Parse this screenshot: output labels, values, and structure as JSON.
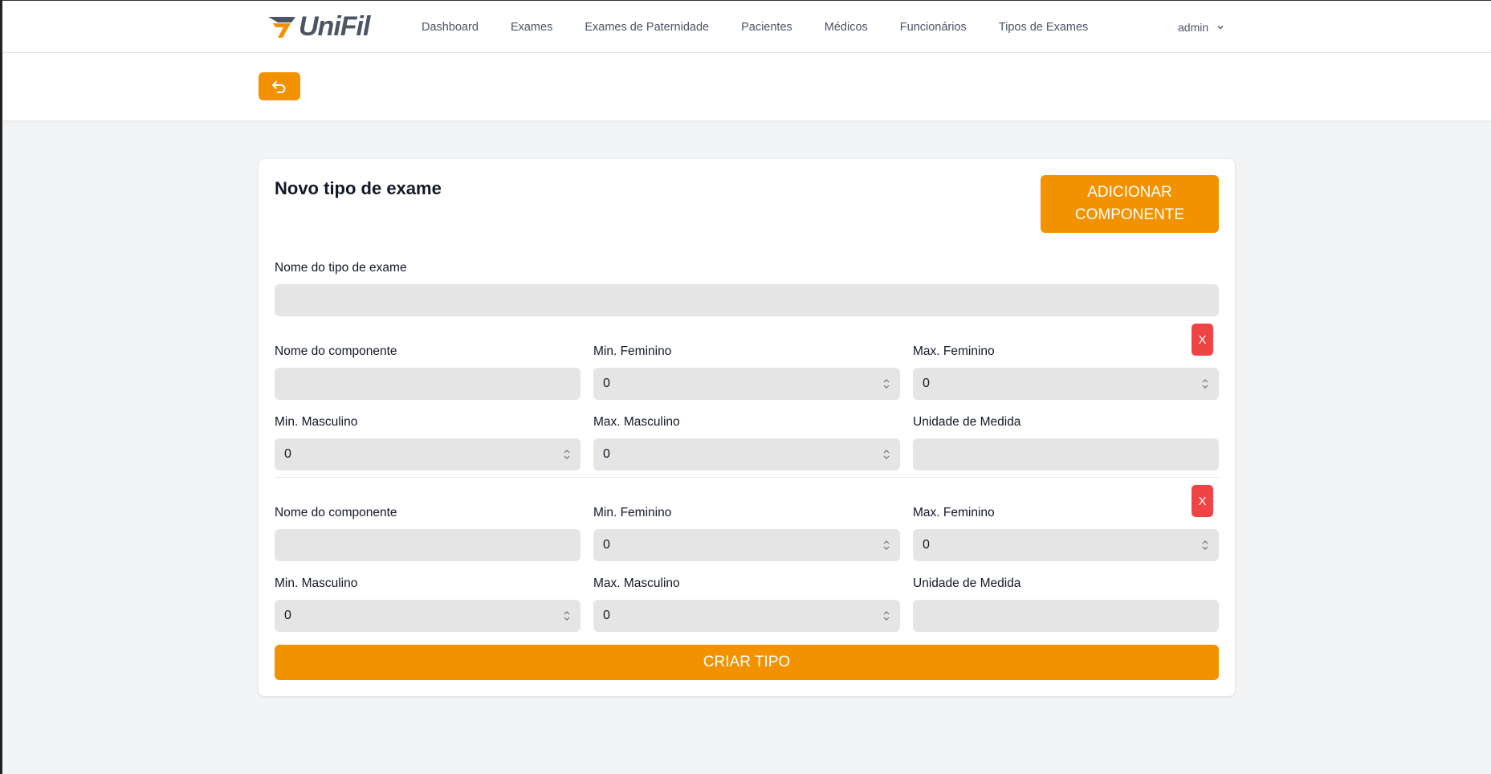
{
  "brand": {
    "logo_text": "UniFil",
    "accent_color": "#f39200",
    "danger_color": "#ef4444"
  },
  "nav": {
    "links": [
      "Dashboard",
      "Exames",
      "Exames de Paternidade",
      "Pacientes",
      "Médicos",
      "Funcionários",
      "Tipos de Exames"
    ],
    "user": "admin",
    "user_icon": "chevron-down-icon"
  },
  "header": {
    "back_icon": "undo-arrow-icon"
  },
  "form": {
    "title": "Novo tipo de exame",
    "add_component_label": "ADICIONAR\nCOMPONENTE",
    "exam_name_label": "Nome do tipo de exame",
    "exam_name_value": "",
    "components": [
      {
        "remove_label": "X",
        "labels": {
          "name": "Nome do componente",
          "min_f": "Min. Feminino",
          "max_f": "Max. Feminino",
          "min_m": "Min. Masculino",
          "max_m": "Max. Masculino",
          "unit": "Unidade de Medida"
        },
        "values": {
          "name": "",
          "min_f": "0",
          "max_f": "0",
          "min_m": "0",
          "max_m": "0",
          "unit": ""
        }
      },
      {
        "remove_label": "X",
        "labels": {
          "name": "Nome do componente",
          "min_f": "Min. Feminino",
          "max_f": "Max. Feminino",
          "min_m": "Min. Masculino",
          "max_m": "Max. Masculino",
          "unit": "Unidade de Medida"
        },
        "values": {
          "name": "",
          "min_f": "0",
          "max_f": "0",
          "min_m": "0",
          "max_m": "0",
          "unit": ""
        }
      }
    ],
    "submit_label": "CRIAR TIPO"
  }
}
